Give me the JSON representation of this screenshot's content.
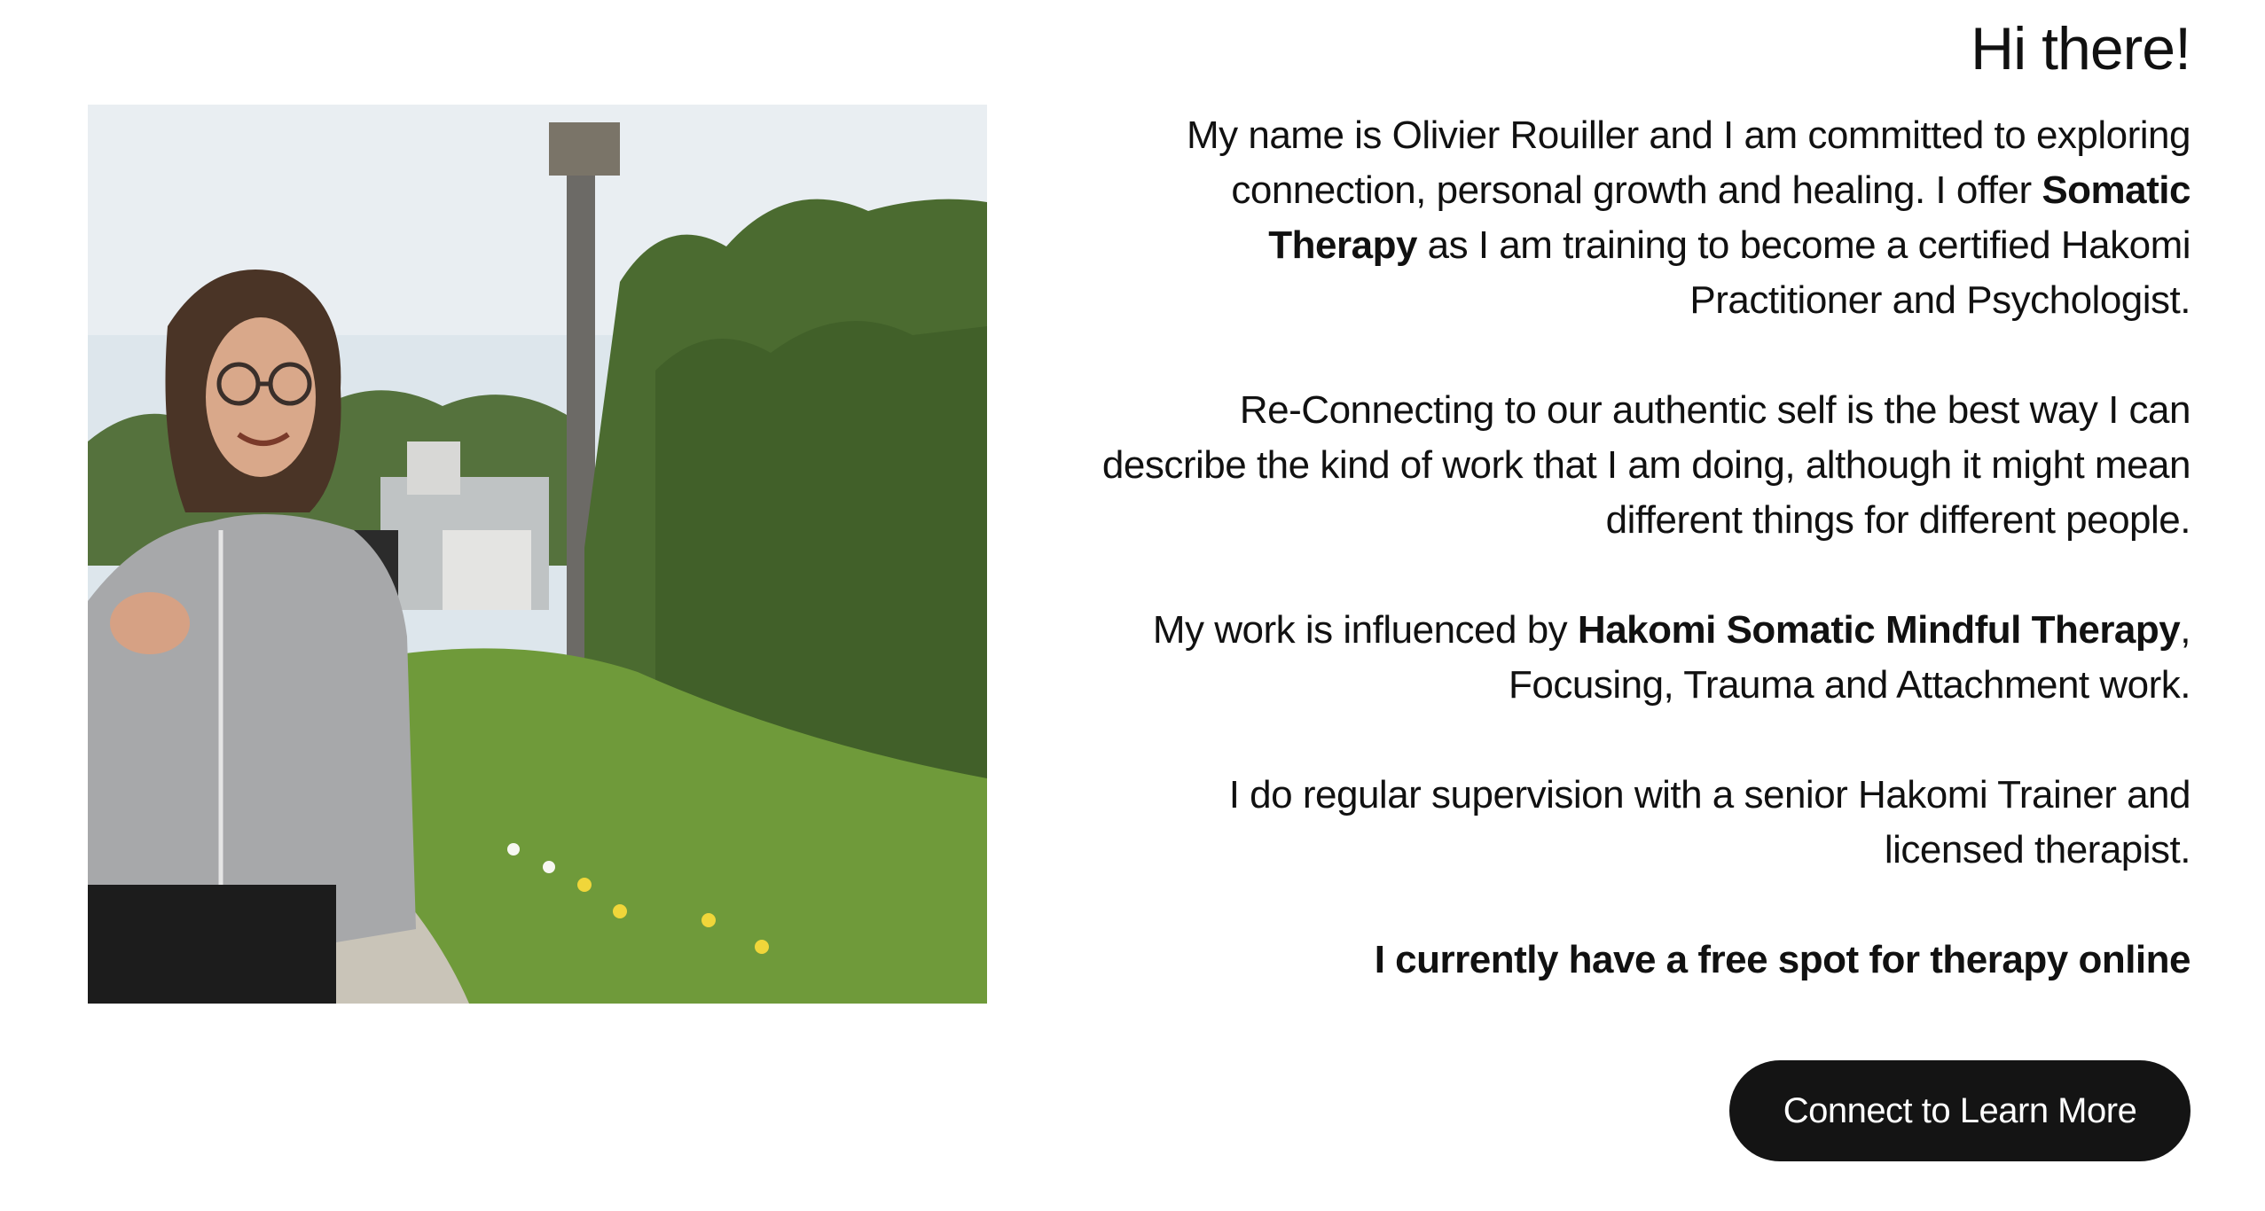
{
  "photo": {
    "alt": "Olivier Rouiller portrait outdoors"
  },
  "intro": {
    "heading": "Hi there!",
    "p1": {
      "a": "My name is Olivier Rouiller and I am committed to exploring connection, personal growth and healing. I offer ",
      "b_bold": "Somatic Therapy",
      "c": " as I am training to become a certified Hakomi Practitioner and Psychologist."
    },
    "p2": "Re-Connecting to our authentic self is the best way I can describe the kind of work that I am doing, although it might mean different things for different people.",
    "p3": {
      "a": "My work is influenced by ",
      "b_bold": "Hakomi Somatic Mindful Therapy",
      "c": ", Focusing, Trauma and Attachment work."
    },
    "p4": "I do regular supervision with a senior Hakomi Trainer and licensed therapist.",
    "availability": "I currently have a free spot for therapy online"
  },
  "cta": {
    "label": "Connect to Learn More"
  },
  "colors": {
    "button_bg": "#141414",
    "button_text": "#ffffff",
    "text": "#111111",
    "background": "#ffffff"
  }
}
